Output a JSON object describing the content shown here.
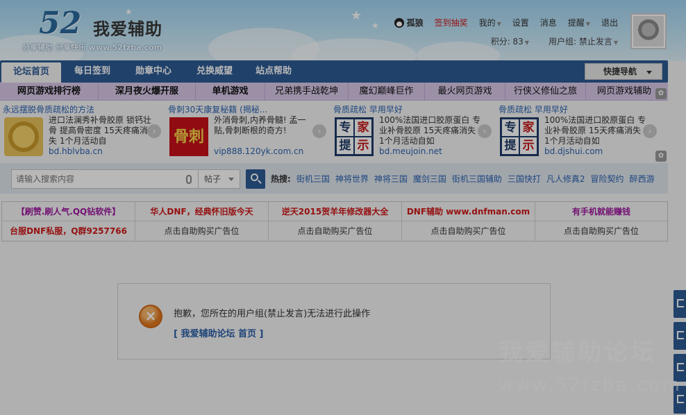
{
  "header": {
    "logo_number": "52",
    "logo_name": "我爱辅助",
    "logo_slogan": "分享辅助  分享快乐  www.52fzba.com",
    "user_name": "孤狼",
    "checkin_link": "签到抽奖",
    "my_menu": "我的",
    "settings": "设置",
    "messages": "消息",
    "reminders": "提醒",
    "logout": "退出",
    "points": "积分: 83",
    "user_group": "用户组: 禁止发言"
  },
  "nav": {
    "tabs": [
      "论坛首页",
      "每日签到",
      "勋章中心",
      "兑换威望",
      "站点帮助"
    ],
    "quick_nav": "快捷导航"
  },
  "games": [
    "网页游戏排行榜",
    "深月夜火爆开服",
    "单机游戏",
    "兄弟携手战乾坤",
    "魔幻巅峰巨作",
    "最火网页游戏",
    "行侠义修仙之旅",
    "网页游戏辅助"
  ],
  "ads": [
    {
      "title": "永远摆脱骨质疏松的方法",
      "desc": "进口法澜秀补骨胶原 锁钙壮骨 提高骨密度 15天疼痛消失 1个月活动自",
      "url": "bd.hblvba.cn",
      "thumb_text": ""
    },
    {
      "title": "骨刺30天康复秘籍 (揭秘...",
      "desc": "外消骨刺,内养骨髓! 孟一贴,骨刺断根的奇方!",
      "url": "vip888.120yk.com.cn",
      "thumb_text": "骨刺"
    },
    {
      "title": "骨质疏松  早用早好",
      "desc": "100%法国进口胶原蛋白 专业补骨胶原 15天疼痛消失 1个月活动自如",
      "url": "bd.meujoin.net",
      "thumb_text": [
        "专",
        "家",
        "提",
        "示"
      ]
    },
    {
      "title": "骨质疏松  早用早好",
      "desc": "100%法国进口胶原蛋白 专业补骨胶原 15天疼痛消失 1个月活动自如",
      "url": "bd.djshui.com",
      "thumb_text": [
        "专",
        "家",
        "提",
        "示"
      ]
    }
  ],
  "search": {
    "placeholder": "请输入搜索内容",
    "type": "帖子",
    "hot_label": "热搜:",
    "hot_keywords": [
      "街机三国",
      "神将世界",
      "神将三国",
      "魔剑三国",
      "街机三国辅助",
      "三国快打",
      "凡人修真2",
      "冒险契约",
      "醉西游"
    ]
  },
  "text_ads": {
    "row1": [
      "【刷赞.刷人气.QQ钻软件】",
      "华人DNF，经典怀旧版今天",
      "逆天2015贺羊年修改器大全",
      "DNF辅助 www.dnfman.com",
      "有手机就能赚钱"
    ],
    "row2": [
      "台服DNF私服，Q群9257766",
      "点击自助购买广告位",
      "点击自助购买广告位",
      "点击自助购买广告位",
      "点击自助购买广告位"
    ]
  },
  "message": {
    "text": "抱歉，您所在的用户组(禁止发言)无法进行此操作",
    "link": "[ 我爱辅助论坛 首页 ]"
  },
  "watermark": {
    "line1": "我爱辅助论坛",
    "line2": "www.52fzba.com"
  },
  "colors": {
    "nav_blue": "#2d5a94",
    "link_blue": "#2a62b0",
    "alert_red": "#d01818"
  }
}
